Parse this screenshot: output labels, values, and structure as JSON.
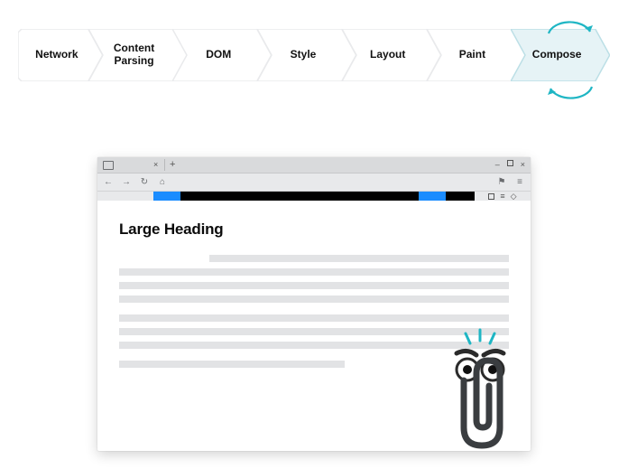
{
  "pipeline": {
    "stages": [
      {
        "label": "Network",
        "active": false
      },
      {
        "label": "Content\nParsing",
        "active": false
      },
      {
        "label": "DOM",
        "active": false
      },
      {
        "label": "Style",
        "active": false
      },
      {
        "label": "Layout",
        "active": false
      },
      {
        "label": "Paint",
        "active": false
      },
      {
        "label": "Compose",
        "active": true
      }
    ],
    "colors": {
      "inactive_fill": "#ffffff",
      "inactive_stroke": "#e9eaec",
      "active_fill": "#e6f3f6",
      "active_stroke": "#bcdfe6",
      "arrow": "#1fb6c4"
    }
  },
  "browser": {
    "tab_close_glyph": "×",
    "new_tab_glyph": "+",
    "window_ctrl": {
      "min": "–",
      "close": "×"
    },
    "toolbar": {
      "back_glyph": "←",
      "forward_glyph": "→",
      "reload_glyph": "↻",
      "home_glyph": "⌂",
      "flag_glyph": "⚑",
      "drop_glyph": "≡"
    },
    "loadbar_icons": {
      "rows": "≡",
      "drop": "◇"
    },
    "page": {
      "heading": "Large Heading"
    }
  }
}
